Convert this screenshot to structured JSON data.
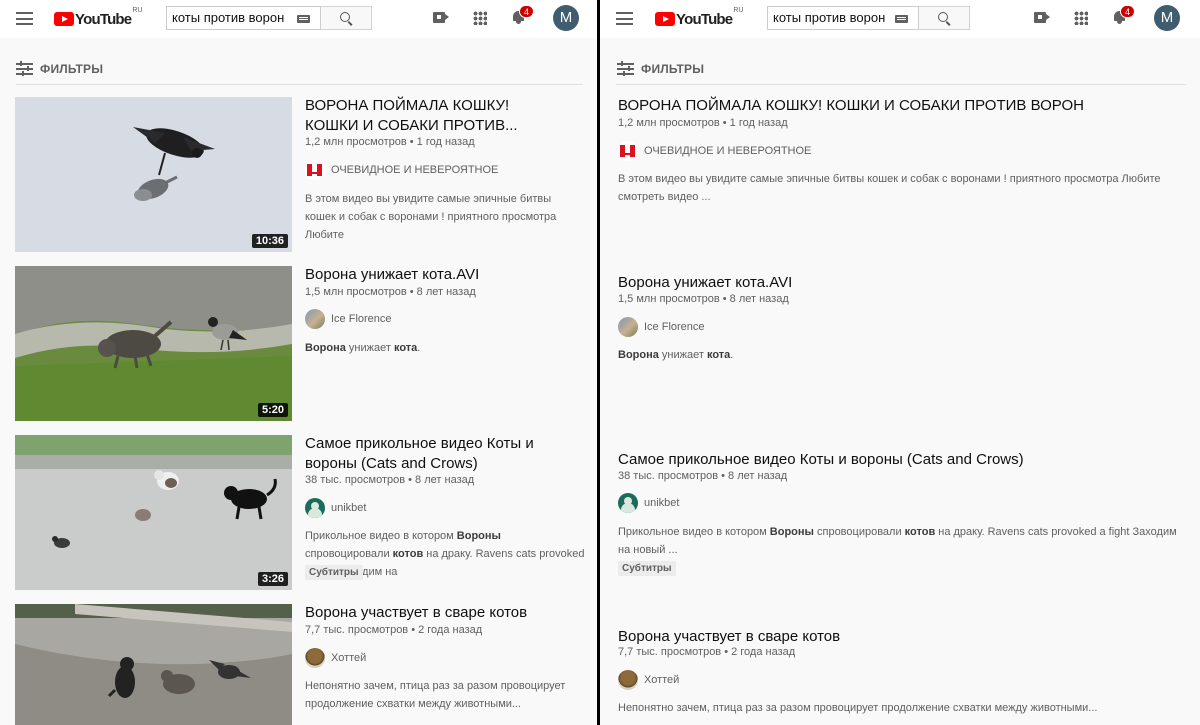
{
  "app": {
    "logo_text": "YouTube",
    "logo_region": "RU",
    "search_query": "коты против ворон",
    "notifications_count": "4",
    "avatar_letter": "M",
    "filters_label": "ФИЛЬТРЫ"
  },
  "left": {
    "videos": [
      {
        "title": "ВОРОНА ПОЙМАЛА КОШКУ! КОШКИ И СОБАКИ ПРОТИВ...",
        "meta": "1,2 млн просмотров • 1 год назад",
        "channel": "ОЧЕВИДНОЕ И НЕВЕРОЯТНОЕ",
        "desc": "В этом видео вы увидите самые эпичные битвы кошек и собак с воронами ! приятного просмотра Любите",
        "duration": "10:36"
      },
      {
        "title": "Ворона унижает кота.AVI",
        "meta": "1,5 млн просмотров • 8 лет назад",
        "channel": "Ice Florence",
        "desc_1": "Ворона",
        "desc_2": " унижает ",
        "desc_3": "кота",
        "desc_4": ".",
        "duration": "5:20"
      },
      {
        "title": "Самое прикольное видео Коты и вороны (Cats and Crows)",
        "meta": "38 тыс. просмотров • 8 лет назад",
        "channel": "unikbet",
        "desc_1": "Прикольное видео в котором ",
        "desc_2": "Вороны",
        "desc_3": " спровоцировали ",
        "desc_4": "котов",
        "desc_5": " на драку. Ravens cats provoked a fight Заходим на",
        "subs": "Субтитры",
        "duration": "3:26"
      },
      {
        "title": "Ворона участвует в сваре котов",
        "meta": "7,7 тыс. просмотров • 2 года назад",
        "channel": "Хоттей",
        "desc": "Непонятно зачем, птица раз за разом провоцирует продолжение схватки между животными..."
      }
    ]
  },
  "right": {
    "videos": [
      {
        "title": "ВОРОНА ПОЙМАЛА КОШКУ! КОШКИ И СОБАКИ ПРОТИВ ВОРОН",
        "meta": "1,2 млн просмотров • 1 год назад",
        "channel": "ОЧЕВИДНОЕ И НЕВЕРОЯТНОЕ",
        "desc": "В этом видео вы увидите самые эпичные битвы кошек и собак с воронами ! приятного просмотра Любите смотреть видео ..."
      },
      {
        "title": "Ворона унижает кота.AVI",
        "meta": "1,5 млн просмотров • 8 лет назад",
        "channel": "Ice Florence",
        "desc_1": "Ворона",
        "desc_2": " унижает ",
        "desc_3": "кота",
        "desc_4": "."
      },
      {
        "title": "Самое прикольное видео Коты и вороны (Cats and Crows)",
        "meta": "38 тыс. просмотров • 8 лет назад",
        "channel": "unikbet",
        "desc_1": "Прикольное видео в котором ",
        "desc_2": "Вороны",
        "desc_3": " спровоцировали ",
        "desc_4": "котов",
        "desc_5": " на драку. Ravens cats provoked a fight Заходим на новый ...",
        "subs": "Субтитры"
      },
      {
        "title": "Ворона участвует в сваре котов",
        "meta": "7,7 тыс. просмотров • 2 года назад",
        "channel": "Хоттей",
        "desc": "Непонятно зачем, птица раз за разом провоцирует продолжение схватки между животными..."
      }
    ]
  }
}
